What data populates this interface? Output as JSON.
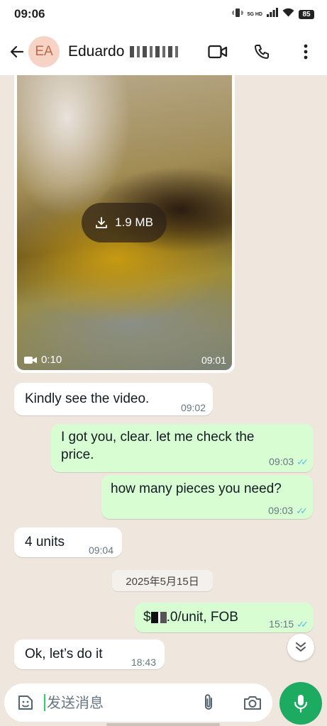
{
  "status_bar": {
    "time": "09:06",
    "network": "5G HD",
    "battery": "85"
  },
  "header": {
    "avatar_initials": "EA",
    "contact_name": "Eduardo"
  },
  "video_message": {
    "size": "1.9 MB",
    "duration": "0:10",
    "time": "09:01"
  },
  "messages": [
    {
      "direction": "in",
      "text": "Kindly see the video.",
      "time": "09:02"
    },
    {
      "direction": "out",
      "text_line1": "I got you, clear. let me check the",
      "text_line2": "price.",
      "time": "09:03",
      "ticks": "✓✓"
    },
    {
      "direction": "out",
      "text": "how many pieces you need?",
      "time": "09:03",
      "ticks": "✓✓"
    },
    {
      "direction": "in",
      "text": "4 units",
      "time": "09:04"
    },
    {
      "direction": "out",
      "text_prefix": "$",
      "text_suffix": ".0/unit, FOB",
      "time": "15:15",
      "ticks": "✓✓"
    },
    {
      "direction": "in",
      "text": "Ok, let’s do it",
      "time": "18:43"
    }
  ],
  "date_divider": "2025年5月15日",
  "composer": {
    "placeholder": "发送消息"
  },
  "colors": {
    "outgoing_bubble": "#d9fdd3",
    "incoming_bubble": "#ffffff",
    "chat_background": "#efe7de",
    "accent_green": "#1daa61",
    "read_ticks": "#53bdeb"
  }
}
